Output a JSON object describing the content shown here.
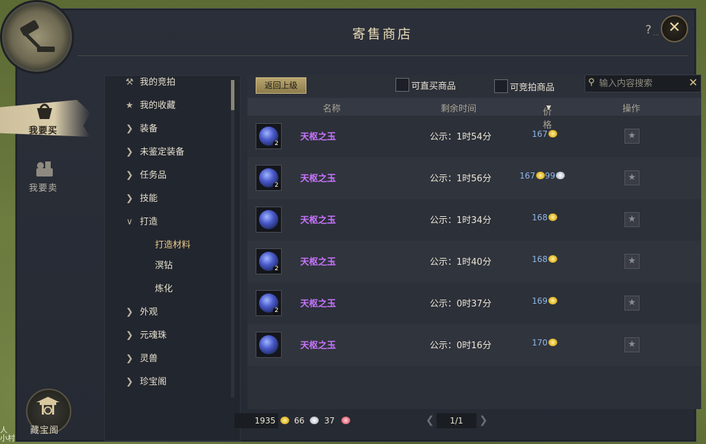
{
  "window": {
    "title": "寄售商店",
    "help": "?",
    "help_dots": "···",
    "close": "✕"
  },
  "world_text": {
    "line1": "人",
    "line2": "小村"
  },
  "side_tabs": [
    {
      "label": "我要买",
      "active": true
    },
    {
      "label": "我要卖",
      "active": false
    }
  ],
  "pavilion": {
    "label": "藏宝阁"
  },
  "categories": [
    {
      "label": "我的竞拍",
      "icon": "gavel-icon"
    },
    {
      "label": "我的收藏",
      "icon": "star-icon"
    },
    {
      "label": "装备",
      "icon": "chevron-right-icon"
    },
    {
      "label": "未鉴定装备",
      "icon": "chevron-right-icon"
    },
    {
      "label": "任务品",
      "icon": "chevron-right-icon"
    },
    {
      "label": "技能",
      "icon": "chevron-right-icon"
    },
    {
      "label": "打造",
      "icon": "chevron-down-icon"
    },
    {
      "label": "打造材料",
      "sub": true,
      "active": true
    },
    {
      "label": "溟钻",
      "sub": true
    },
    {
      "label": "炼化",
      "sub": true
    },
    {
      "label": "外观",
      "icon": "chevron-right-icon"
    },
    {
      "label": "元魂珠",
      "icon": "chevron-right-icon"
    },
    {
      "label": "灵兽",
      "icon": "chevron-right-icon"
    },
    {
      "label": "珍宝阁",
      "icon": "chevron-right-icon"
    }
  ],
  "toolbar": {
    "back_label": "返回上级",
    "filter_buy_now": "可直买商品",
    "filter_bid": "可竞拍商品",
    "search_placeholder": "输入内容搜索"
  },
  "columns": {
    "name": "名称",
    "time": "剩余时间",
    "price": "价格",
    "action": "操作"
  },
  "listings": [
    {
      "name": "天枢之玉",
      "count": "2",
      "time": "公示：1时54分",
      "gold": "167",
      "silver": ""
    },
    {
      "name": "天枢之玉",
      "count": "2",
      "time": "公示：1时56分",
      "gold": "167",
      "silver": "99"
    },
    {
      "name": "天枢之玉",
      "count": "",
      "time": "公示：1时34分",
      "gold": "168",
      "silver": ""
    },
    {
      "name": "天枢之玉",
      "count": "2",
      "time": "公示：1时40分",
      "gold": "168",
      "silver": ""
    },
    {
      "name": "天枢之玉",
      "count": "2",
      "time": "公示：0时37分",
      "gold": "169",
      "silver": ""
    },
    {
      "name": "天枢之玉",
      "count": "",
      "time": "公示：0时16分",
      "gold": "170",
      "silver": ""
    }
  ],
  "wallet": {
    "gold": "1935",
    "silver": "66",
    "red": "37"
  },
  "pager": {
    "page": "1/1"
  },
  "colors": {
    "item_name": "#c874ff",
    "price": "#8fb8e8",
    "accent": "#e8c98a"
  }
}
